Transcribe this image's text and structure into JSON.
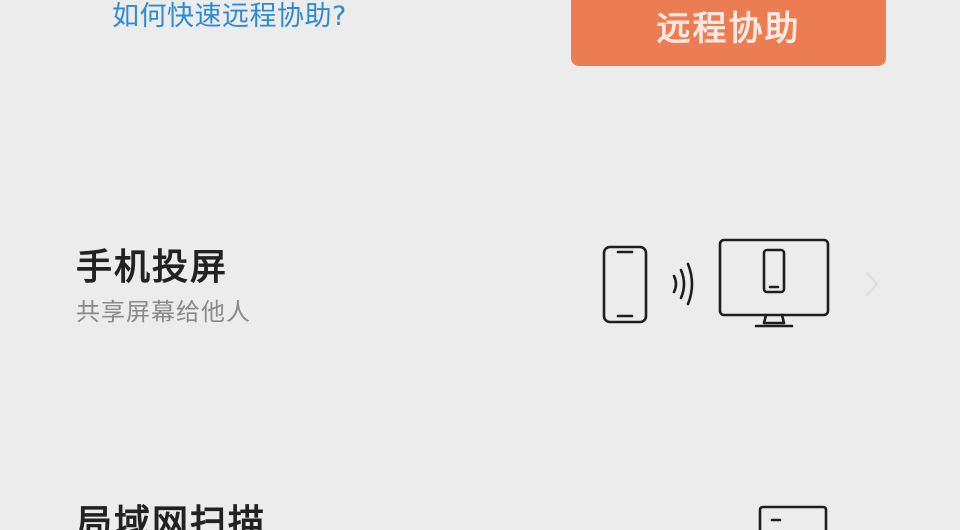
{
  "header": {
    "help_link": "如何快速远程协助?",
    "remote_assist_button": "远程协助"
  },
  "features": [
    {
      "title": "手机投屏",
      "subtitle": "共享屏幕给他人",
      "icon": "phone-cast-to-monitor-icon"
    },
    {
      "title": "局域网扫描",
      "icon": "monitor-icon"
    }
  ],
  "colors": {
    "background": "#ececec",
    "accent_button": "#ec7d52",
    "link": "#2d8bd6",
    "title_text": "#222222",
    "subtitle_text": "#8a8a8a"
  }
}
